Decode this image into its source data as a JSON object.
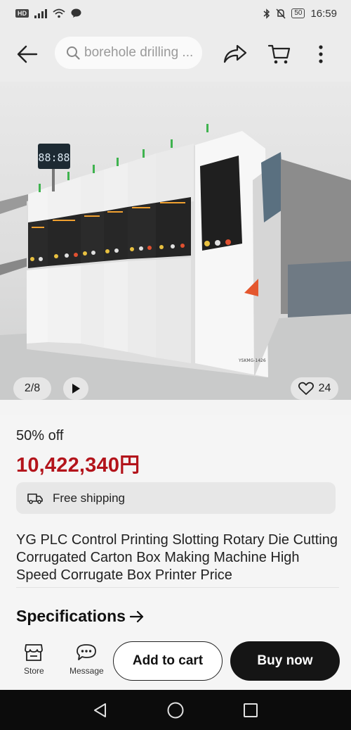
{
  "status_bar": {
    "network_label": "HD",
    "time": "16:59",
    "battery": "50"
  },
  "header": {
    "search_placeholder": "borehole drilling ..."
  },
  "gallery": {
    "counter": "2/8",
    "likes": "24",
    "machine_label": "YSKMG-1426",
    "display_digits": "88:88"
  },
  "product": {
    "discount": "50% off",
    "price": "10,422,340円",
    "shipping": "Free shipping",
    "title": "YG PLC Control Printing Slotting Rotary Die Cutting Corrugated Carton Box Making Machine High Speed Corrugate Box Printer Price",
    "specs_label": "Specifications"
  },
  "actions": {
    "store_label": "Store",
    "message_label": "Message",
    "add_to_cart_label": "Add to cart",
    "buy_now_label": "Buy now"
  },
  "colors": {
    "price": "#b3141b",
    "buy_button": "#151515",
    "nav_bar": "#0c0c0c"
  }
}
